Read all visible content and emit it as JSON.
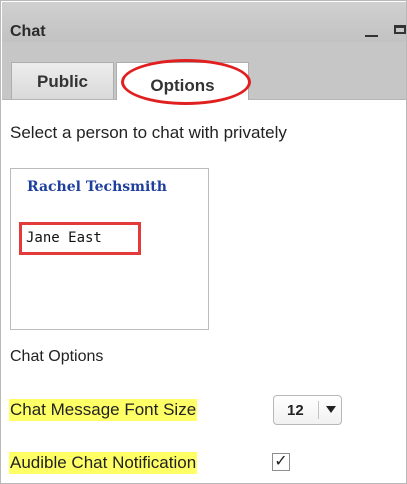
{
  "panel": {
    "title": "Chat",
    "minimize_icon": "minimize-icon",
    "maximize_icon": "maximize-icon"
  },
  "tabs": [
    {
      "label": "Public",
      "active": false
    },
    {
      "label": "Options",
      "active": true
    }
  ],
  "instruction": "Select a person to chat with privately",
  "people": [
    {
      "name": "Rachel Techsmith",
      "color": "#1f3f9f"
    },
    {
      "name": "Jane East"
    }
  ],
  "chat_options": {
    "heading": "Chat Options",
    "font_size": {
      "label": "Chat Message Font Size",
      "value": "12"
    },
    "audible_notification": {
      "label": "Audible Chat Notification",
      "checked": true,
      "check_glyph": "✓"
    }
  },
  "colors": {
    "highlight": "#ffff66",
    "annotation_red": "#e02020",
    "link_blue": "#1f3f9f",
    "titlebar_gray": "#c6c6c6"
  }
}
